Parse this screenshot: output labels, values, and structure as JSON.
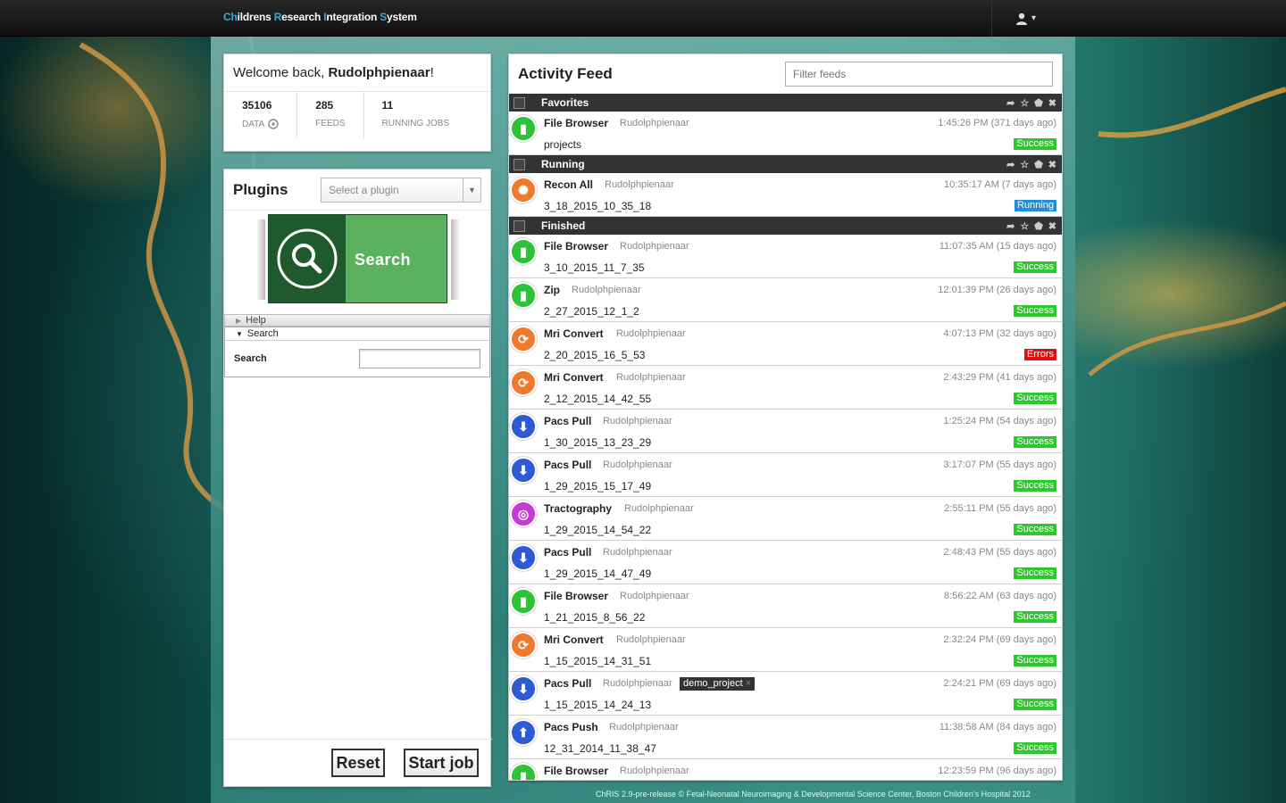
{
  "app": {
    "brand_letters": [
      "Ch",
      "ildrens ",
      "R",
      "esearch ",
      "I",
      "ntegration ",
      "S",
      "ystem"
    ]
  },
  "header": {
    "user_icon": "user-icon",
    "caret": "▾"
  },
  "welcome": {
    "greeting": "Welcome back, ",
    "username": "Rudolphpienaar",
    "exclaim": "!",
    "stats": [
      {
        "value": "35106",
        "label": "DATA"
      },
      {
        "value": "285",
        "label": "FEEDS"
      },
      {
        "value": "11",
        "label": "RUNNING JOBS"
      }
    ]
  },
  "plugins": {
    "title": "Plugins",
    "select_placeholder": "Select a plugin",
    "tile_label": "Search",
    "help_label": "Help",
    "search_section": "Search",
    "search_field_label": "Search",
    "reset": "Reset",
    "start": "Start job"
  },
  "feed": {
    "title": "Activity Feed",
    "filter_placeholder": "Filter feeds",
    "groups": {
      "favorites": "Favorites",
      "running": "Running",
      "finished": "Finished"
    },
    "items": [
      {
        "name": "File Browser",
        "user": "Rudolphpienaar",
        "time": "1:45:26 PM (371 days ago)",
        "id": "projects",
        "status": "Success"
      },
      {
        "name": "Recon All",
        "user": "Rudolphpienaar",
        "time": "10:35:17 AM (7 days ago)",
        "id": "3_18_2015_10_35_18",
        "status": "Running"
      },
      {
        "name": "File Browser",
        "user": "Rudolphpienaar",
        "time": "11:07:35 AM (15 days ago)",
        "id": "3_10_2015_11_7_35",
        "status": "Success"
      },
      {
        "name": "Zip",
        "user": "Rudolphpienaar",
        "time": "12:01:39 PM (26 days ago)",
        "id": "2_27_2015_12_1_2",
        "status": "Success"
      },
      {
        "name": "Mri Convert",
        "user": "Rudolphpienaar",
        "time": "4:07:13 PM (32 days ago)",
        "id": "2_20_2015_16_5_53",
        "status": "Errors"
      },
      {
        "name": "Mri Convert",
        "user": "Rudolphpienaar",
        "time": "2:43:29 PM (41 days ago)",
        "id": "2_12_2015_14_42_55",
        "status": "Success"
      },
      {
        "name": "Pacs Pull",
        "user": "Rudolphpienaar",
        "time": "1:25:24 PM (54 days ago)",
        "id": "1_30_2015_13_23_29",
        "status": "Success"
      },
      {
        "name": "Pacs Pull",
        "user": "Rudolphpienaar",
        "time": "3:17:07 PM (55 days ago)",
        "id": "1_29_2015_15_17_49",
        "status": "Success"
      },
      {
        "name": "Tractography",
        "user": "Rudolphpienaar",
        "time": "2:55:11 PM (55 days ago)",
        "id": "1_29_2015_14_54_22",
        "status": "Success"
      },
      {
        "name": "Pacs Pull",
        "user": "Rudolphpienaar",
        "time": "2:48:43 PM (55 days ago)",
        "id": "1_29_2015_14_47_49",
        "status": "Success"
      },
      {
        "name": "File Browser",
        "user": "Rudolphpienaar",
        "time": "8:56:22 AM (63 days ago)",
        "id": "1_21_2015_8_56_22",
        "status": "Success"
      },
      {
        "name": "Mri Convert",
        "user": "Rudolphpienaar",
        "time": "2:32:24 PM (69 days ago)",
        "id": "1_15_2015_14_31_51",
        "status": "Success"
      },
      {
        "name": "Pacs Pull",
        "user": "Rudolphpienaar",
        "time": "2:24:21 PM (69 days ago)",
        "id": "1_15_2015_14_24_13",
        "status": "Success",
        "tag": "demo_project"
      },
      {
        "name": "Pacs Push",
        "user": "Rudolphpienaar",
        "time": "11:38:58 AM (84 days ago)",
        "id": "12_31_2014_11_38_47",
        "status": "Success"
      },
      {
        "name": "File Browser",
        "user": "Rudolphpienaar",
        "time": "12:23:59 PM (96 days ago)",
        "id": "",
        "status": ""
      }
    ]
  },
  "footer": "ChRIS 2.9-pre-release © Fetal-Neonatal Neuroimaging & Developmental Science Center, Boston Children's Hospital 2012",
  "colors": {
    "success": "#2ec82e",
    "errors": "#e01010",
    "running": "#1e8fd8",
    "brand_accent": "#35a8e0"
  }
}
